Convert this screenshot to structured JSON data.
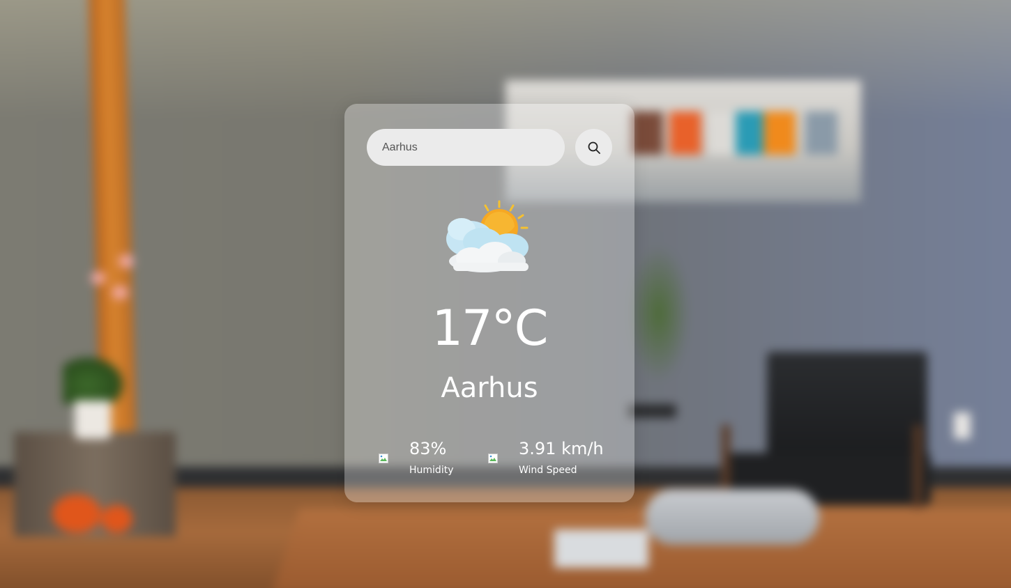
{
  "search": {
    "value": "Aarhus",
    "placeholder": "",
    "button_icon": "search-icon"
  },
  "weather": {
    "icon": "partly-cloudy-sun-icon",
    "temperature": "17°C",
    "city": "Aarhus"
  },
  "details": {
    "humidity": {
      "icon": "broken-image-icon",
      "value": "83%",
      "label": "Humidity"
    },
    "wind": {
      "icon": "broken-image-icon",
      "value": "3.91 km/h",
      "label": "Wind Speed"
    }
  },
  "colors": {
    "card_glass": "#ffffff4d",
    "input_bg": "#ebebeb",
    "text": "#ffffff",
    "sun": "#f6a823",
    "cloud": "#bfe3f2"
  }
}
